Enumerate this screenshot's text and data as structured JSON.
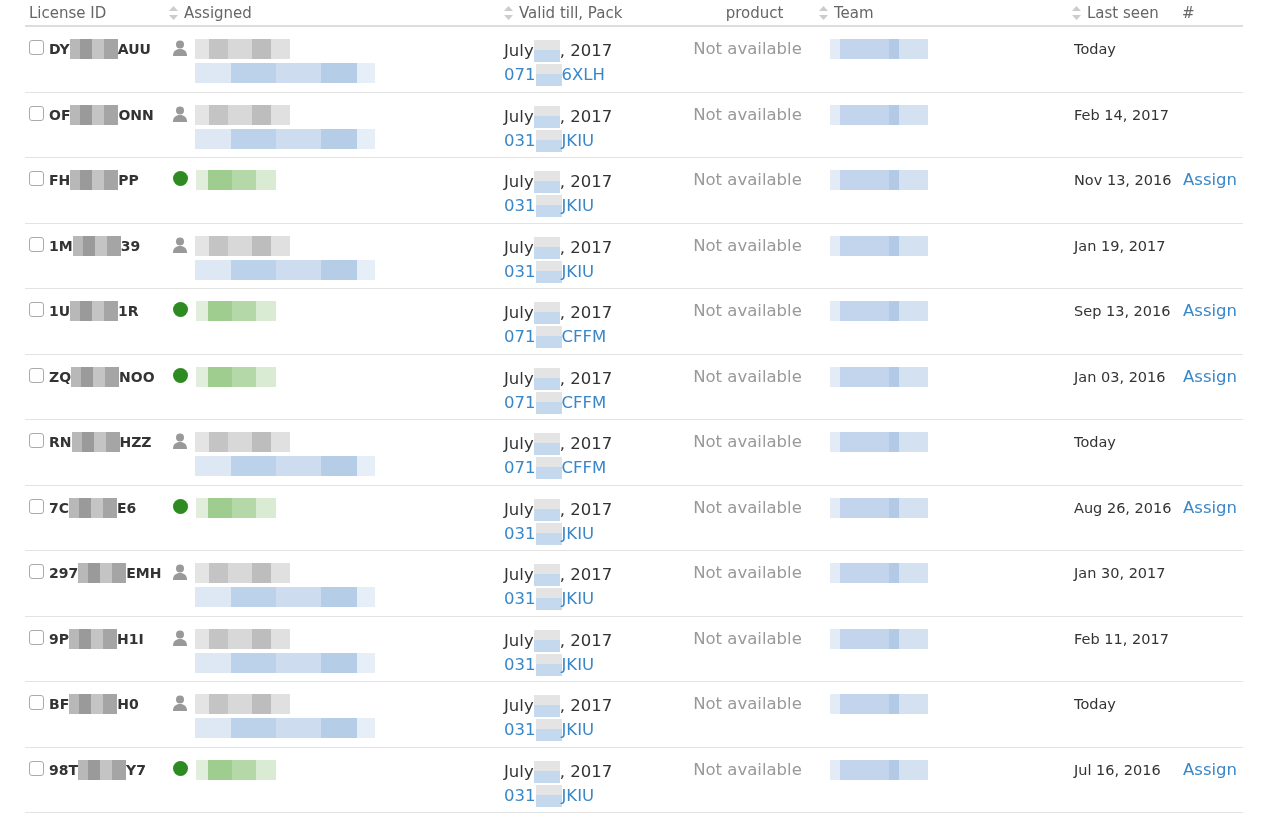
{
  "table": {
    "columns": [
      {
        "label": "License ID",
        "sortable": false
      },
      {
        "label": "Assigned",
        "sortable": true
      },
      {
        "label": "Valid till, Pack",
        "sortable": true
      },
      {
        "label": "product",
        "sortable": false
      },
      {
        "label": "Team",
        "sortable": true
      },
      {
        "label": "Last seen",
        "sortable": true
      },
      {
        "label": "#",
        "sortable": false
      }
    ],
    "rows": [
      {
        "checked": false,
        "id_start": "DY",
        "id_end": "AUU",
        "kind": "user",
        "valid_start": "July",
        "valid_end": ", 2017",
        "pack_start": "071",
        "pack_end": "6XLH",
        "product": "Not available",
        "last_seen": "Today"
      },
      {
        "checked": false,
        "id_start": "OF",
        "id_end": "ONN",
        "kind": "user",
        "valid_start": "July",
        "valid_end": ", 2017",
        "pack_start": "031",
        "pack_end": "JKIU",
        "product": "Not available",
        "last_seen": "Feb 14, 2017"
      },
      {
        "checked": false,
        "id_start": "FH",
        "id_end": "PP",
        "kind": "dot",
        "valid_start": "July",
        "valid_end": ", 2017",
        "pack_start": "031",
        "pack_end": "JKIU",
        "product": "Not available",
        "last_seen": "Nov 13, 2016",
        "action": "Assign"
      },
      {
        "checked": false,
        "id_start": "1M",
        "id_end": "39",
        "kind": "user",
        "valid_start": "July",
        "valid_end": ", 2017",
        "pack_start": "031",
        "pack_end": "JKIU",
        "product": "Not available",
        "last_seen": "Jan 19, 2017"
      },
      {
        "checked": false,
        "id_start": "1U",
        "id_end": "1R",
        "kind": "dot",
        "valid_start": "July",
        "valid_end": ", 2017",
        "pack_start": "071",
        "pack_end": "CFFM",
        "product": "Not available",
        "last_seen": "Sep 13, 2016",
        "action": "Assign"
      },
      {
        "checked": false,
        "id_start": "ZQ",
        "id_end": "NOO",
        "kind": "dot",
        "valid_start": "July",
        "valid_end": ", 2017",
        "pack_start": "071",
        "pack_end": "CFFM",
        "product": "Not available",
        "last_seen": "Jan 03, 2016",
        "action": "Assign"
      },
      {
        "checked": false,
        "id_start": "RN",
        "id_end": "HZZ",
        "kind": "user",
        "valid_start": "July",
        "valid_end": ", 2017",
        "pack_start": "071",
        "pack_end": "CFFM",
        "product": "Not available",
        "last_seen": "Today"
      },
      {
        "checked": false,
        "id_start": "7C",
        "id_end": "E6",
        "kind": "dot",
        "valid_start": "July",
        "valid_end": ", 2017",
        "pack_start": "031",
        "pack_end": "JKIU",
        "product": "Not available",
        "last_seen": "Aug 26, 2016",
        "action": "Assign"
      },
      {
        "checked": false,
        "id_start": "297",
        "id_end": "EMH",
        "kind": "user",
        "valid_start": "July",
        "valid_end": ", 2017",
        "pack_start": "031",
        "pack_end": "JKIU",
        "product": "Not available",
        "last_seen": "Jan 30, 2017"
      },
      {
        "checked": false,
        "id_start": "9P",
        "id_end": "H1I",
        "kind": "user",
        "valid_start": "July",
        "valid_end": ", 2017",
        "pack_start": "031",
        "pack_end": "JKIU",
        "product": "Not available",
        "last_seen": "Feb 11, 2017"
      },
      {
        "checked": false,
        "id_start": "BF",
        "id_end": "H0",
        "kind": "user",
        "valid_start": "July",
        "valid_end": ", 2017",
        "pack_start": "031",
        "pack_end": "JKIU",
        "product": "Not available",
        "last_seen": "Today"
      },
      {
        "checked": false,
        "id_start": "98T",
        "id_end": "Y7",
        "kind": "dot",
        "valid_start": "July",
        "valid_end": ", 2017",
        "pack_start": "031",
        "pack_end": "JKIU",
        "product": "Not available",
        "last_seen": "Jul 16, 2016",
        "action": "Assign"
      }
    ]
  }
}
